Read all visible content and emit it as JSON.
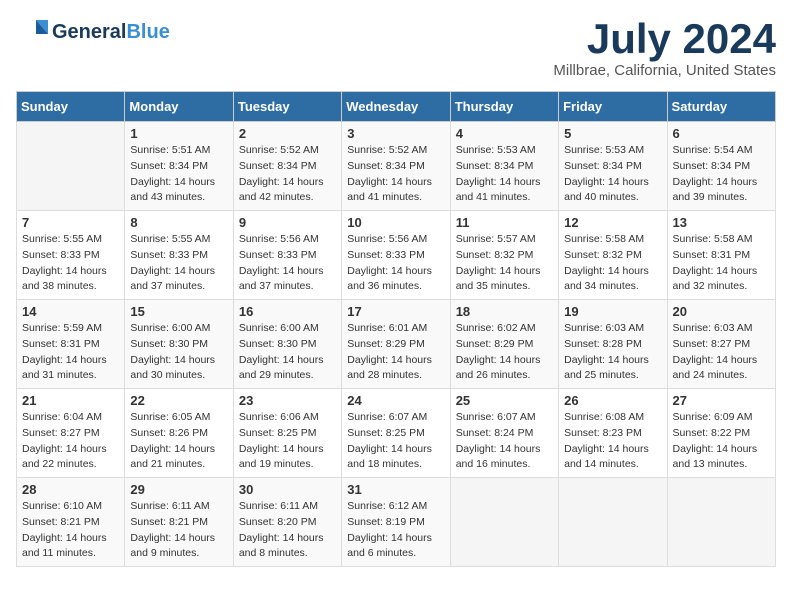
{
  "logo": {
    "line1": "General",
    "line2": "Blue",
    "tagline": ""
  },
  "title": "July 2024",
  "location": "Millbrae, California, United States",
  "days_of_week": [
    "Sunday",
    "Monday",
    "Tuesday",
    "Wednesday",
    "Thursday",
    "Friday",
    "Saturday"
  ],
  "weeks": [
    [
      {
        "day": "",
        "content": ""
      },
      {
        "day": "1",
        "content": "Sunrise: 5:51 AM\nSunset: 8:34 PM\nDaylight: 14 hours\nand 43 minutes."
      },
      {
        "day": "2",
        "content": "Sunrise: 5:52 AM\nSunset: 8:34 PM\nDaylight: 14 hours\nand 42 minutes."
      },
      {
        "day": "3",
        "content": "Sunrise: 5:52 AM\nSunset: 8:34 PM\nDaylight: 14 hours\nand 41 minutes."
      },
      {
        "day": "4",
        "content": "Sunrise: 5:53 AM\nSunset: 8:34 PM\nDaylight: 14 hours\nand 41 minutes."
      },
      {
        "day": "5",
        "content": "Sunrise: 5:53 AM\nSunset: 8:34 PM\nDaylight: 14 hours\nand 40 minutes."
      },
      {
        "day": "6",
        "content": "Sunrise: 5:54 AM\nSunset: 8:34 PM\nDaylight: 14 hours\nand 39 minutes."
      }
    ],
    [
      {
        "day": "7",
        "content": "Sunrise: 5:55 AM\nSunset: 8:33 PM\nDaylight: 14 hours\nand 38 minutes."
      },
      {
        "day": "8",
        "content": "Sunrise: 5:55 AM\nSunset: 8:33 PM\nDaylight: 14 hours\nand 37 minutes."
      },
      {
        "day": "9",
        "content": "Sunrise: 5:56 AM\nSunset: 8:33 PM\nDaylight: 14 hours\nand 37 minutes."
      },
      {
        "day": "10",
        "content": "Sunrise: 5:56 AM\nSunset: 8:33 PM\nDaylight: 14 hours\nand 36 minutes."
      },
      {
        "day": "11",
        "content": "Sunrise: 5:57 AM\nSunset: 8:32 PM\nDaylight: 14 hours\nand 35 minutes."
      },
      {
        "day": "12",
        "content": "Sunrise: 5:58 AM\nSunset: 8:32 PM\nDaylight: 14 hours\nand 34 minutes."
      },
      {
        "day": "13",
        "content": "Sunrise: 5:58 AM\nSunset: 8:31 PM\nDaylight: 14 hours\nand 32 minutes."
      }
    ],
    [
      {
        "day": "14",
        "content": "Sunrise: 5:59 AM\nSunset: 8:31 PM\nDaylight: 14 hours\nand 31 minutes."
      },
      {
        "day": "15",
        "content": "Sunrise: 6:00 AM\nSunset: 8:30 PM\nDaylight: 14 hours\nand 30 minutes."
      },
      {
        "day": "16",
        "content": "Sunrise: 6:00 AM\nSunset: 8:30 PM\nDaylight: 14 hours\nand 29 minutes."
      },
      {
        "day": "17",
        "content": "Sunrise: 6:01 AM\nSunset: 8:29 PM\nDaylight: 14 hours\nand 28 minutes."
      },
      {
        "day": "18",
        "content": "Sunrise: 6:02 AM\nSunset: 8:29 PM\nDaylight: 14 hours\nand 26 minutes."
      },
      {
        "day": "19",
        "content": "Sunrise: 6:03 AM\nSunset: 8:28 PM\nDaylight: 14 hours\nand 25 minutes."
      },
      {
        "day": "20",
        "content": "Sunrise: 6:03 AM\nSunset: 8:27 PM\nDaylight: 14 hours\nand 24 minutes."
      }
    ],
    [
      {
        "day": "21",
        "content": "Sunrise: 6:04 AM\nSunset: 8:27 PM\nDaylight: 14 hours\nand 22 minutes."
      },
      {
        "day": "22",
        "content": "Sunrise: 6:05 AM\nSunset: 8:26 PM\nDaylight: 14 hours\nand 21 minutes."
      },
      {
        "day": "23",
        "content": "Sunrise: 6:06 AM\nSunset: 8:25 PM\nDaylight: 14 hours\nand 19 minutes."
      },
      {
        "day": "24",
        "content": "Sunrise: 6:07 AM\nSunset: 8:25 PM\nDaylight: 14 hours\nand 18 minutes."
      },
      {
        "day": "25",
        "content": "Sunrise: 6:07 AM\nSunset: 8:24 PM\nDaylight: 14 hours\nand 16 minutes."
      },
      {
        "day": "26",
        "content": "Sunrise: 6:08 AM\nSunset: 8:23 PM\nDaylight: 14 hours\nand 14 minutes."
      },
      {
        "day": "27",
        "content": "Sunrise: 6:09 AM\nSunset: 8:22 PM\nDaylight: 14 hours\nand 13 minutes."
      }
    ],
    [
      {
        "day": "28",
        "content": "Sunrise: 6:10 AM\nSunset: 8:21 PM\nDaylight: 14 hours\nand 11 minutes."
      },
      {
        "day": "29",
        "content": "Sunrise: 6:11 AM\nSunset: 8:21 PM\nDaylight: 14 hours\nand 9 minutes."
      },
      {
        "day": "30",
        "content": "Sunrise: 6:11 AM\nSunset: 8:20 PM\nDaylight: 14 hours\nand 8 minutes."
      },
      {
        "day": "31",
        "content": "Sunrise: 6:12 AM\nSunset: 8:19 PM\nDaylight: 14 hours\nand 6 minutes."
      },
      {
        "day": "",
        "content": ""
      },
      {
        "day": "",
        "content": ""
      },
      {
        "day": "",
        "content": ""
      }
    ]
  ]
}
